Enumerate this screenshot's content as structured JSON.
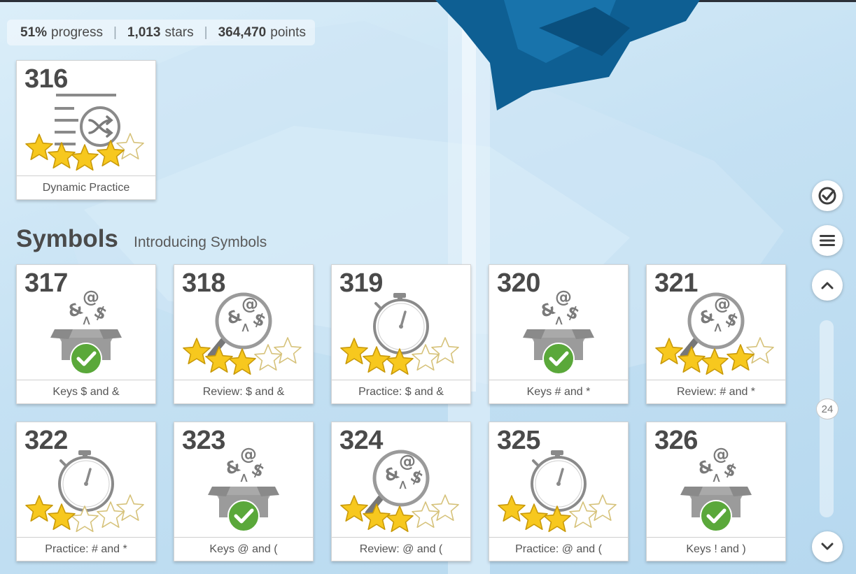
{
  "stats": {
    "progress_value": "51%",
    "progress_label": "progress",
    "stars_value": "1,013",
    "stars_label": "stars",
    "points_value": "364,470",
    "points_label": "points",
    "separator": "|"
  },
  "section": {
    "title": "Symbols",
    "subtitle": "Introducing Symbols"
  },
  "lessons": [
    {
      "number": "316",
      "label": "Dynamic Practice",
      "type": "dynamic",
      "stars": 4
    },
    {
      "number": "317",
      "label": "Keys $ and &",
      "type": "keys",
      "completed": true
    },
    {
      "number": "318",
      "label": "Review: $ and &",
      "type": "review",
      "stars": 3
    },
    {
      "number": "319",
      "label": "Practice: $ and &",
      "type": "practice",
      "stars": 3
    },
    {
      "number": "320",
      "label": "Keys # and *",
      "type": "keys",
      "completed": true
    },
    {
      "number": "321",
      "label": "Review: # and *",
      "type": "review",
      "stars": 4
    },
    {
      "number": "322",
      "label": "Practice: # and *",
      "type": "practice",
      "stars": 2
    },
    {
      "number": "323",
      "label": "Keys @ and (",
      "type": "keys",
      "completed": true
    },
    {
      "number": "324",
      "label": "Review: @ and (",
      "type": "review",
      "stars": 3
    },
    {
      "number": "325",
      "label": "Practice: @ and (",
      "type": "practice",
      "stars": 3
    },
    {
      "number": "326",
      "label": "Keys ! and )",
      "type": "keys",
      "completed": true
    }
  ],
  "sidebar": {
    "buttons": [
      {
        "name": "goals-button",
        "icon": "check-circle-icon"
      },
      {
        "name": "menu-button",
        "icon": "hamburger-icon"
      },
      {
        "name": "scroll-up-button",
        "icon": "chevron-up-icon"
      },
      {
        "name": "scroll-down-button",
        "icon": "chevron-down-icon"
      }
    ],
    "scroll_position": "24"
  },
  "colors": {
    "star_fill": "#f7c81e",
    "star_empty": "#ffffff",
    "check_green": "#5aa83a",
    "box_gray": "#8c8c8c",
    "text_dark": "#4a4a4a",
    "background": "#c5e1f3"
  }
}
